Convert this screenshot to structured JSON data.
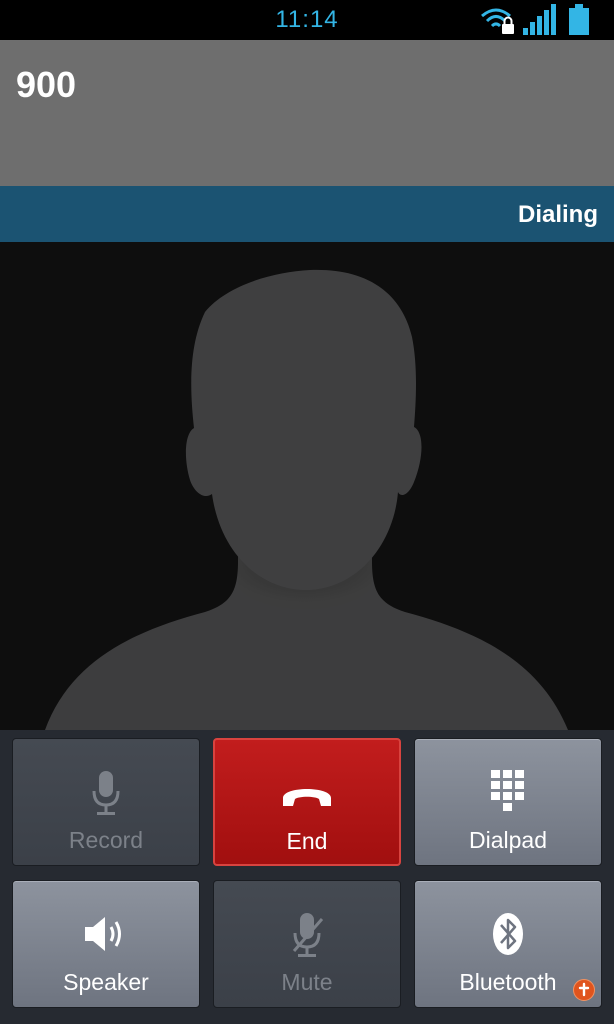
{
  "status_bar": {
    "time": "11:14",
    "icons": [
      "wifi-lock-icon",
      "signal-icon",
      "battery-icon"
    ]
  },
  "call": {
    "number": "900",
    "status": "Dialing"
  },
  "colors": {
    "status_time": "#33b5e5",
    "caller_area": "#6e6e6e",
    "status_strip": "#1b5372",
    "end_button": "#b31515"
  },
  "controls": {
    "record": {
      "label": "Record",
      "icon": "microphone-icon",
      "enabled": false
    },
    "end": {
      "label": "End",
      "icon": "end-call-icon",
      "enabled": true
    },
    "dialpad": {
      "label": "Dialpad",
      "icon": "dialpad-icon",
      "enabled": true
    },
    "speaker": {
      "label": "Speaker",
      "icon": "speaker-icon",
      "enabled": true
    },
    "mute": {
      "label": "Mute",
      "icon": "mute-icon",
      "enabled": false
    },
    "bluetooth": {
      "label": "Bluetooth",
      "icon": "bluetooth-icon",
      "enabled": true
    }
  }
}
